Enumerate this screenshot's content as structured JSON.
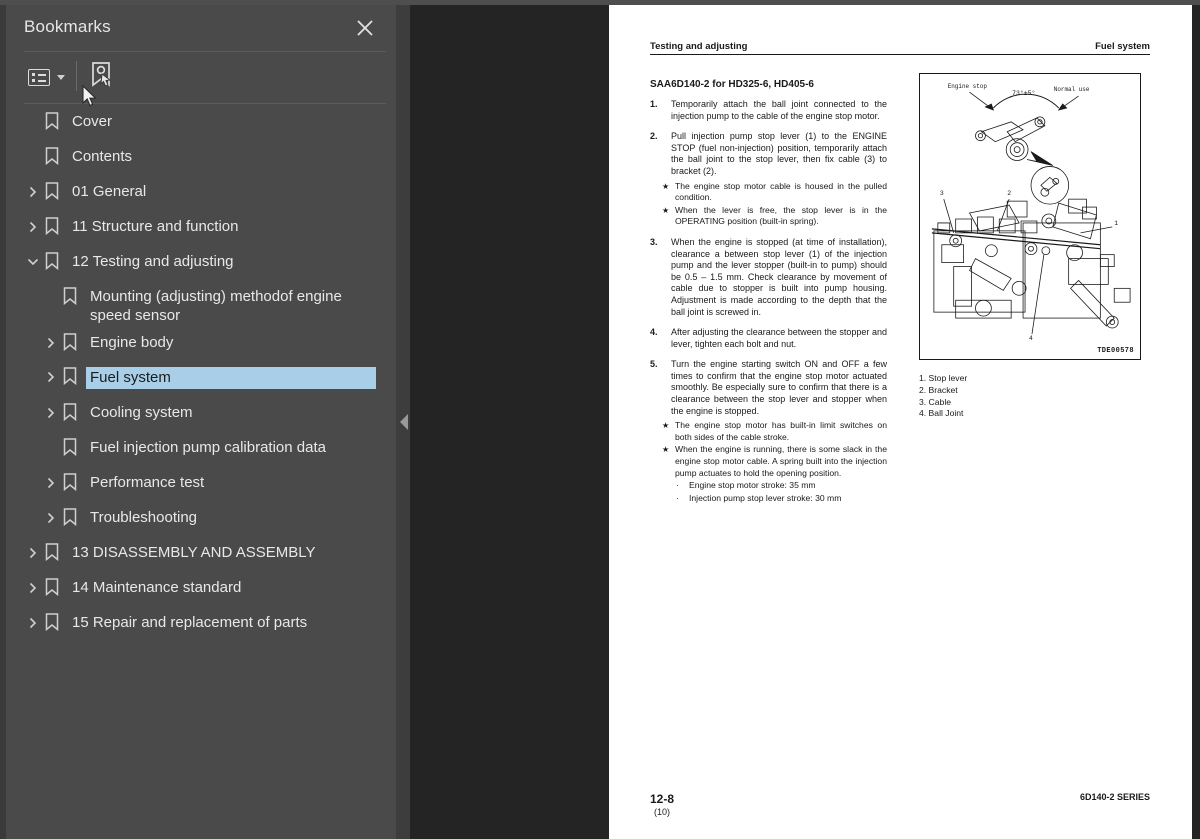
{
  "panel": {
    "title": "Bookmarks",
    "close_icon": "close-icon",
    "toolbar": {
      "options_label": "bookmark-list-options",
      "new_bookmark_label": "new-bookmark"
    },
    "items": [
      {
        "label": "Cover",
        "level": 1,
        "twisty": "none",
        "selected": false
      },
      {
        "label": "Contents",
        "level": 1,
        "twisty": "none",
        "selected": false
      },
      {
        "label": "01 General",
        "level": 1,
        "twisty": "collapsed",
        "selected": false
      },
      {
        "label": "11 Structure and function",
        "level": 1,
        "twisty": "collapsed",
        "selected": false
      },
      {
        "label": "12 Testing and adjusting",
        "level": 1,
        "twisty": "expanded",
        "selected": false
      },
      {
        "label": "Mounting (adjusting) methodof engine speed sensor",
        "level": 2,
        "twisty": "none",
        "selected": false
      },
      {
        "label": "Engine body",
        "level": 2,
        "twisty": "collapsed",
        "selected": false
      },
      {
        "label": "Fuel system",
        "level": 2,
        "twisty": "collapsed",
        "selected": true
      },
      {
        "label": "Cooling system",
        "level": 2,
        "twisty": "collapsed",
        "selected": false
      },
      {
        "label": "Fuel injection pump calibration data",
        "level": 2,
        "twisty": "none",
        "selected": false
      },
      {
        "label": "Performance test",
        "level": 2,
        "twisty": "collapsed",
        "selected": false
      },
      {
        "label": "Troubleshooting",
        "level": 2,
        "twisty": "collapsed",
        "selected": false
      },
      {
        "label": "13 DISASSEMBLY AND ASSEMBLY",
        "level": 1,
        "twisty": "collapsed",
        "selected": false
      },
      {
        "label": "14 Maintenance standard",
        "level": 1,
        "twisty": "collapsed",
        "selected": false
      },
      {
        "label": "15 Repair and replacement of parts",
        "level": 1,
        "twisty": "collapsed",
        "selected": false
      }
    ]
  },
  "viewer": {
    "collapse_handle": "collapse-sidebar"
  },
  "document": {
    "header_left": "Testing and adjusting",
    "header_right": "Fuel system",
    "section_title": "SAA6D140-2 for HD325-6, HD405-6",
    "steps": [
      {
        "num": "1.",
        "text": "Temporarily attach the ball joint connected to the injection pump to the cable of the engine stop motor.",
        "bullets": [],
        "subbullets": []
      },
      {
        "num": "2.",
        "text": "Pull injection pump stop lever (1) to the ENGINE STOP (fuel non-injection) position, temporarily attach the ball joint to the stop lever, then fix cable (3) to bracket (2).",
        "bullets": [
          "The engine stop motor cable is housed in the pulled condition.",
          "When the lever is free, the stop lever is in the OPERATING position (built-in spring)."
        ],
        "subbullets": []
      },
      {
        "num": "3.",
        "text": "When the engine is stopped (at time of installation), clearance a between stop lever (1) of the injection pump and the lever stopper (built-in to pump) should be 0.5 – 1.5 mm. Check clearance by movement of cable due to stopper is built into pump housing. Adjustment is made according to the depth that the ball joint is screwed in.",
        "bullets": [],
        "subbullets": []
      },
      {
        "num": "4.",
        "text": "After adjusting the clearance between the stopper and lever, tighten each bolt and nut.",
        "bullets": [],
        "subbullets": []
      },
      {
        "num": "5.",
        "text": "Turn the engine starting switch ON and OFF a few times to confirm that the engine stop motor actuated smoothly. Be especially sure to confirm that there is a clearance between the stop lever and stopper when the engine is stopped.",
        "bullets": [
          "The engine stop motor has built-in limit switches on both sides of the cable stroke.",
          "When the engine is running, there is some slack in the engine stop motor cable. A spring built into the injection pump actuates to hold the opening position."
        ],
        "subbullets": [
          "Engine stop motor stroke: 35 mm",
          "Injection pump stop lever stroke: 30 mm"
        ]
      }
    ],
    "figure": {
      "code": "TDE00578",
      "labels": {
        "engine_stop": "Engine stop",
        "angle": "73°±5°",
        "normal_use": "Normal use",
        "callout_1": "1",
        "callout_2": "2",
        "callout_3": "3",
        "callout_4": "4"
      }
    },
    "legend": [
      "1. Stop lever",
      "2. Bracket",
      "3. Cable",
      "4. Ball Joint"
    ],
    "footer": {
      "page_number": "12-8",
      "page_sub": "(10)",
      "series": "6D140-2 SERIES"
    }
  }
}
